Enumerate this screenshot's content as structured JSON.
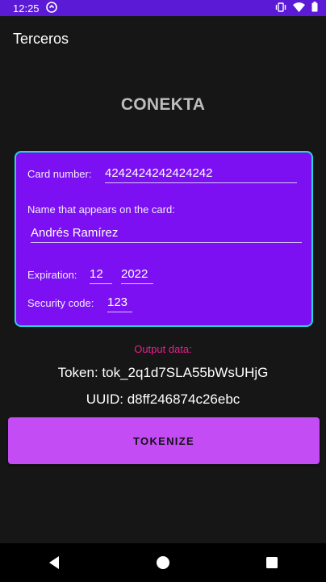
{
  "status_bar": {
    "time": "12:25",
    "icons": [
      "app-notification-icon",
      "vibrate-icon",
      "wifi-icon",
      "battery-icon"
    ]
  },
  "toolbar": {
    "title": "Terceros"
  },
  "brand": {
    "title": "CONEKTA"
  },
  "card_form": {
    "card_number_label": "Card number:",
    "card_number_value": "4242424242424242",
    "name_label": "Name that appears on the card:",
    "name_value": "Andrés Ramírez",
    "expiration_label": "Expiration:",
    "expiration_month": "12",
    "expiration_year": "2022",
    "security_code_label": "Security code:",
    "security_code_value": "123"
  },
  "output": {
    "label": "Output data:",
    "token": "Token: tok_2q1d7SLA55bWsUHjG",
    "uuid": "UUID: d8ff246874c26ebc"
  },
  "actions": {
    "tokenize_label": "TOKENIZE"
  },
  "nav_bar": {
    "icons": [
      "back-icon",
      "home-icon",
      "recents-icon"
    ]
  },
  "colors": {
    "status_bar": "#5b1bd6",
    "background": "#161616",
    "card_background": "#7c10f2",
    "card_border": "#24d6d6",
    "output_label": "#e91e8c",
    "button": "#c44cf5"
  }
}
